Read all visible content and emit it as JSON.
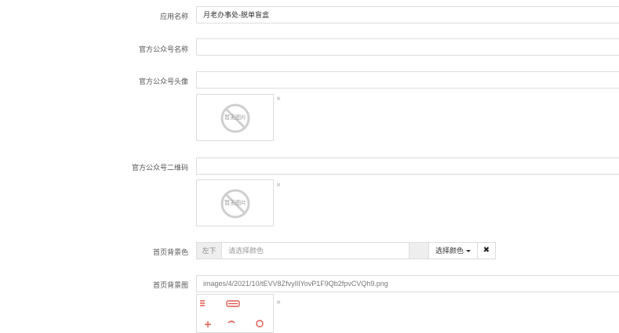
{
  "fields": {
    "app_name": {
      "label": "应用名称",
      "value": "月老办事处-脱单盲盒"
    },
    "official_name": {
      "label": "官方公众号名称",
      "value": ""
    },
    "official_avatar": {
      "label": "官方公众号头像",
      "no_image_text": "暂无图片",
      "remove_icon": "close-icon"
    },
    "official_qrcode": {
      "label": "官方公众号二维码",
      "no_image_text": "暂无图片",
      "remove_icon": "close-icon"
    },
    "home_bg_color": {
      "label": "首页背景色",
      "addon": "左下",
      "placeholder": "请选择颜色",
      "pick_button": "选择颜色",
      "clear_icon": "✖"
    },
    "home_bg_image": {
      "label": "首页背景图",
      "value": "images/4/2021/10/tEVV8ZfvyIlIYovP1F9Qb2fpvCVQh9.png"
    }
  },
  "colors": {
    "border": "#dcdcdc",
    "addon_bg": "#eeeeee",
    "label": "#555555",
    "image_accent": "#e05a4f"
  }
}
